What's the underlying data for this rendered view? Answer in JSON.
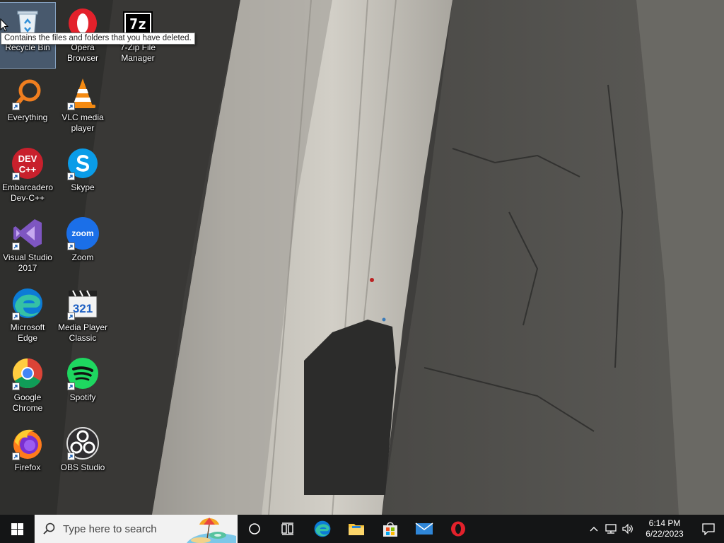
{
  "desktop": {
    "tooltip": "Contains the files and folders that you have deleted.",
    "icons": [
      {
        "label": "Recycle Bin",
        "icon": "recycle-bin-icon"
      },
      {
        "label": "Opera Browser",
        "icon": "opera-icon"
      },
      {
        "label": "7-Zip File Manager",
        "icon": "7zip-icon"
      },
      {
        "label": "Everything",
        "icon": "everything-search-icon"
      },
      {
        "label": "VLC media player",
        "icon": "vlc-icon"
      },
      {
        "label": "Embarcadero Dev-C++",
        "icon": "devcpp-icon"
      },
      {
        "label": "Skype",
        "icon": "skype-icon"
      },
      {
        "label": "Visual Studio 2017",
        "icon": "visual-studio-icon"
      },
      {
        "label": "Zoom",
        "icon": "zoom-icon"
      },
      {
        "label": "Microsoft Edge",
        "icon": "edge-icon"
      },
      {
        "label": "Media Player Classic",
        "icon": "media-player-classic-icon"
      },
      {
        "label": "Google Chrome",
        "icon": "chrome-icon"
      },
      {
        "label": "Spotify",
        "icon": "spotify-icon"
      },
      {
        "label": "Firefox",
        "icon": "firefox-icon"
      },
      {
        "label": "OBS Studio",
        "icon": "obs-icon"
      }
    ],
    "icon_texts": {
      "devcpp_top": "DEV",
      "devcpp_bottom": "C++",
      "zoom": "zoom",
      "mpc_digits": "321",
      "sevenzip": "7z"
    }
  },
  "taskbar": {
    "search_placeholder": "Type here to search",
    "pinned": [
      "task-view",
      "edge",
      "file-explorer",
      "microsoft-store",
      "mail",
      "opera"
    ],
    "clock_time": "6:14 PM",
    "clock_date": "6/22/2023"
  },
  "colors": {
    "taskbar": "#141516",
    "opera_red": "#e3212b",
    "accent_blue": "#0078d7"
  }
}
